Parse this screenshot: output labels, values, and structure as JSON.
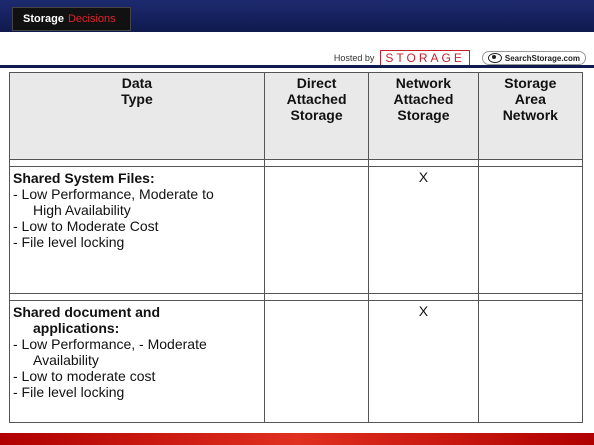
{
  "header": {
    "logo_part1": "Storage",
    "logo_part2": "Decisions",
    "hosted_by": "Hosted by",
    "storage_brand": "STORAGE",
    "searchstorage": "SearchStorage.com"
  },
  "table": {
    "headers": {
      "datatype_line1": "Data",
      "datatype_line2": "Type",
      "das_line1": "Direct",
      "das_line2": "Attached",
      "das_line3": "Storage",
      "nas_line1": "Network",
      "nas_line2": "Attached",
      "nas_line3": "Storage",
      "san_line1": "Storage",
      "san_line2": "Area",
      "san_line3": "Network"
    },
    "rows": [
      {
        "title": "Shared System Files:",
        "line1": "- Low Performance, Moderate to",
        "line1b": "High Availability",
        "line2": "- Low to Moderate Cost",
        "line3": "- File level locking",
        "das": "",
        "nas": "X",
        "san": ""
      },
      {
        "title": "Shared document and",
        "title2": "applications:",
        "line1": "- Low Performance, - Moderate",
        "line1b": "Availability",
        "line2": "- Low to moderate cost",
        "line3": "- File level locking",
        "das": "",
        "nas": "X",
        "san": ""
      }
    ]
  }
}
